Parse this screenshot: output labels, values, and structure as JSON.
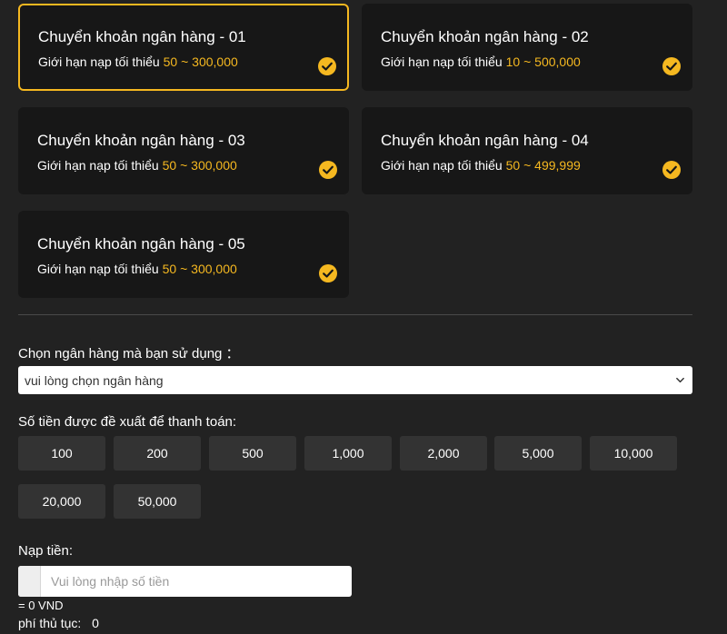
{
  "bank_cards": [
    {
      "title": "Chuyển khoản ngân hàng - 01",
      "limit_prefix": "Giới hạn nạp tối thiểu ",
      "min": "50",
      "sep": " ~ ",
      "max": "300,000"
    },
    {
      "title": "Chuyển khoản ngân hàng - 02",
      "limit_prefix": "Giới hạn nạp tối thiểu ",
      "min": "10",
      "sep": " ~ ",
      "max": "500,000"
    },
    {
      "title": "Chuyển khoản ngân hàng - 03",
      "limit_prefix": "Giới hạn nạp tối thiểu ",
      "min": "50",
      "sep": " ~ ",
      "max": "300,000"
    },
    {
      "title": "Chuyển khoản ngân hàng - 04",
      "limit_prefix": "Giới hạn nạp tối thiểu ",
      "min": "50",
      "sep": " ~ ",
      "max": "499,999"
    },
    {
      "title": "Chuyển khoản ngân hàng - 05",
      "limit_prefix": "Giới hạn nạp tối thiểu ",
      "min": "50",
      "sep": " ~ ",
      "max": "300,000"
    }
  ],
  "selected_card": "Chuyển khoản ngân hàng - 01",
  "bank_select": {
    "label": "Chọn ngân hàng mà bạn sử dụng ：",
    "value": "vui lòng chọn ngân hàng"
  },
  "suggested": {
    "label": "Số tiền được đề xuất để thanh toán:",
    "amounts": [
      "100",
      "200",
      "500",
      "1,000",
      "2,000",
      "5,000",
      "10,000",
      "20,000",
      "50,000"
    ]
  },
  "deposit": {
    "label": "Nạp tiền:",
    "placeholder": "Vui lòng nhập số tiền",
    "converted": "= 0 VND",
    "fee_label": "phí thủ tục:",
    "fee_value": "0"
  },
  "colors": {
    "accent": "#f5b820",
    "background": "#222222",
    "card": "#171717",
    "button": "#333333"
  }
}
